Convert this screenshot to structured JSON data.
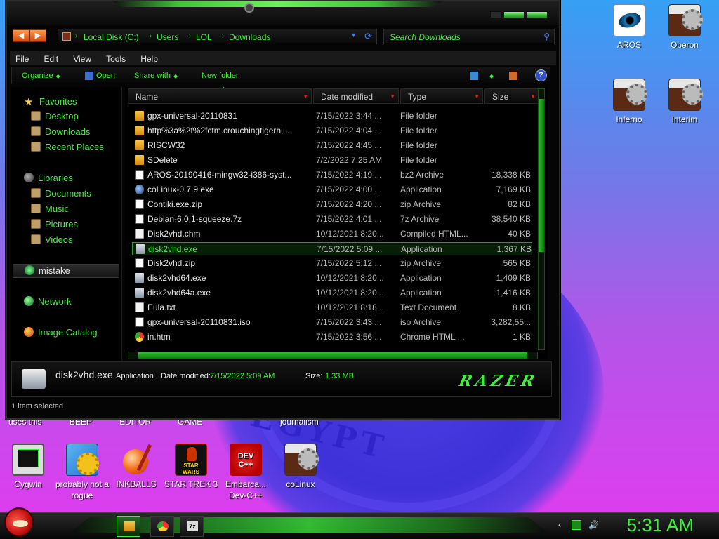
{
  "wallpaper": {
    "text": "EGYPT"
  },
  "desktop_icons_right": [
    {
      "label": "AROS"
    },
    {
      "label": "Oberon"
    },
    {
      "label": "Inferno"
    },
    {
      "label": "Interim"
    }
  ],
  "desktop_partial_labels": [
    "uses this",
    "BEEP",
    "EDITOR",
    "GAME",
    "journalism"
  ],
  "desktop_icons_bottom": [
    {
      "label": "Cygwin"
    },
    {
      "label": "probably not a rogue"
    },
    {
      "label": "INKBALLS"
    },
    {
      "label": "STAR TREK 3"
    },
    {
      "label": "Embarca... Dev-C++"
    },
    {
      "label": "coLinux"
    }
  ],
  "explorer": {
    "address": {
      "segments": [
        "Local Disk (C:)",
        "Users",
        "LOL",
        "Downloads"
      ]
    },
    "search": {
      "placeholder": "Search Downloads"
    },
    "menu": [
      "File",
      "Edit",
      "View",
      "Tools",
      "Help"
    ],
    "commands": {
      "organize": "Organize",
      "open": "Open",
      "share_with": "Share with",
      "new_folder": "New folder"
    },
    "nav": {
      "favorites": "Favorites",
      "desktop": "Desktop",
      "downloads": "Downloads",
      "recent_places": "Recent Places",
      "libraries": "Libraries",
      "documents": "Documents",
      "music": "Music",
      "pictures": "Pictures",
      "videos": "Videos",
      "mistake": "mistake",
      "network": "Network",
      "image_catalog": "Image Catalog"
    },
    "columns": {
      "name": "Name",
      "date": "Date modified",
      "type": "Type",
      "size": "Size"
    },
    "files": [
      {
        "name": "gpx-universal-20110831",
        "date": "7/15/2022 3:44 ...",
        "type": "File folder",
        "size": "",
        "icon": "folder"
      },
      {
        "name": "http%3a%2f%2fctm.crouchingtigerhi...",
        "date": "7/15/2022 4:04 ...",
        "type": "File folder",
        "size": "",
        "icon": "folder"
      },
      {
        "name": "RISCW32",
        "date": "7/15/2022 4:45 ...",
        "type": "File folder",
        "size": "",
        "icon": "folder"
      },
      {
        "name": "SDelete",
        "date": "7/2/2022 7:25 AM",
        "type": "File folder",
        "size": "",
        "icon": "folder"
      },
      {
        "name": "AROS-20190416-mingw32-i386-syst...",
        "date": "7/15/2022 4:19 ...",
        "type": "bz2 Archive",
        "size": "18,338 KB",
        "icon": "archive"
      },
      {
        "name": "coLinux-0.7.9.exe",
        "date": "7/15/2022 4:00 ...",
        "type": "Application",
        "size": "7,169 KB",
        "icon": "globe"
      },
      {
        "name": "Contiki.exe.zip",
        "date": "7/15/2022 4:20 ...",
        "type": "zip Archive",
        "size": "82 KB",
        "icon": "archive"
      },
      {
        "name": "Debian-6.0.1-squeeze.7z",
        "date": "7/15/2022 4:01 ...",
        "type": "7z Archive",
        "size": "38,540 KB",
        "icon": "archive"
      },
      {
        "name": "Disk2vhd.chm",
        "date": "10/12/2021 8:20...",
        "type": "Compiled HTML...",
        "size": "40 KB",
        "icon": "doc"
      },
      {
        "name": "disk2vhd.exe",
        "date": "7/15/2022 5:09 ...",
        "type": "Application",
        "size": "1,367 KB",
        "icon": "app",
        "selected": true
      },
      {
        "name": "Disk2vhd.zip",
        "date": "7/15/2022 5:12 ...",
        "type": "zip Archive",
        "size": "565 KB",
        "icon": "archive"
      },
      {
        "name": "disk2vhd64.exe",
        "date": "10/12/2021 8:20...",
        "type": "Application",
        "size": "1,409 KB",
        "icon": "app"
      },
      {
        "name": "disk2vhd64a.exe",
        "date": "10/12/2021 8:20...",
        "type": "Application",
        "size": "1,416 KB",
        "icon": "app"
      },
      {
        "name": "Eula.txt",
        "date": "10/12/2021 8:18...",
        "type": "Text Document",
        "size": "8 KB",
        "icon": "doc"
      },
      {
        "name": "gpx-universal-20110831.iso",
        "date": "7/15/2022 3:43 ...",
        "type": "iso Archive",
        "size": "3,282,55...",
        "icon": "archive"
      },
      {
        "name": "in.htm",
        "date": "7/15/2022 3:56 ...",
        "type": "Chrome HTML ...",
        "size": "1 KB",
        "icon": "chrome"
      }
    ],
    "details": {
      "name": "disk2vhd.exe",
      "type": "Application",
      "date_label": "Date modified:",
      "date_value": "7/15/2022 5:09 AM",
      "size_label": "Size:",
      "size_value": "1.33 MB",
      "logo": "RAZER"
    },
    "status": "1 item selected"
  },
  "taskbar": {
    "clock": "5:31 AM",
    "buttons": [
      "folder-icon",
      "chrome-icon",
      "7zip-icon"
    ],
    "zip_label": "7z"
  },
  "colors": {
    "accent": "#3ef03a",
    "window_bg": "#050505",
    "sort_arrow": "#e02020"
  }
}
